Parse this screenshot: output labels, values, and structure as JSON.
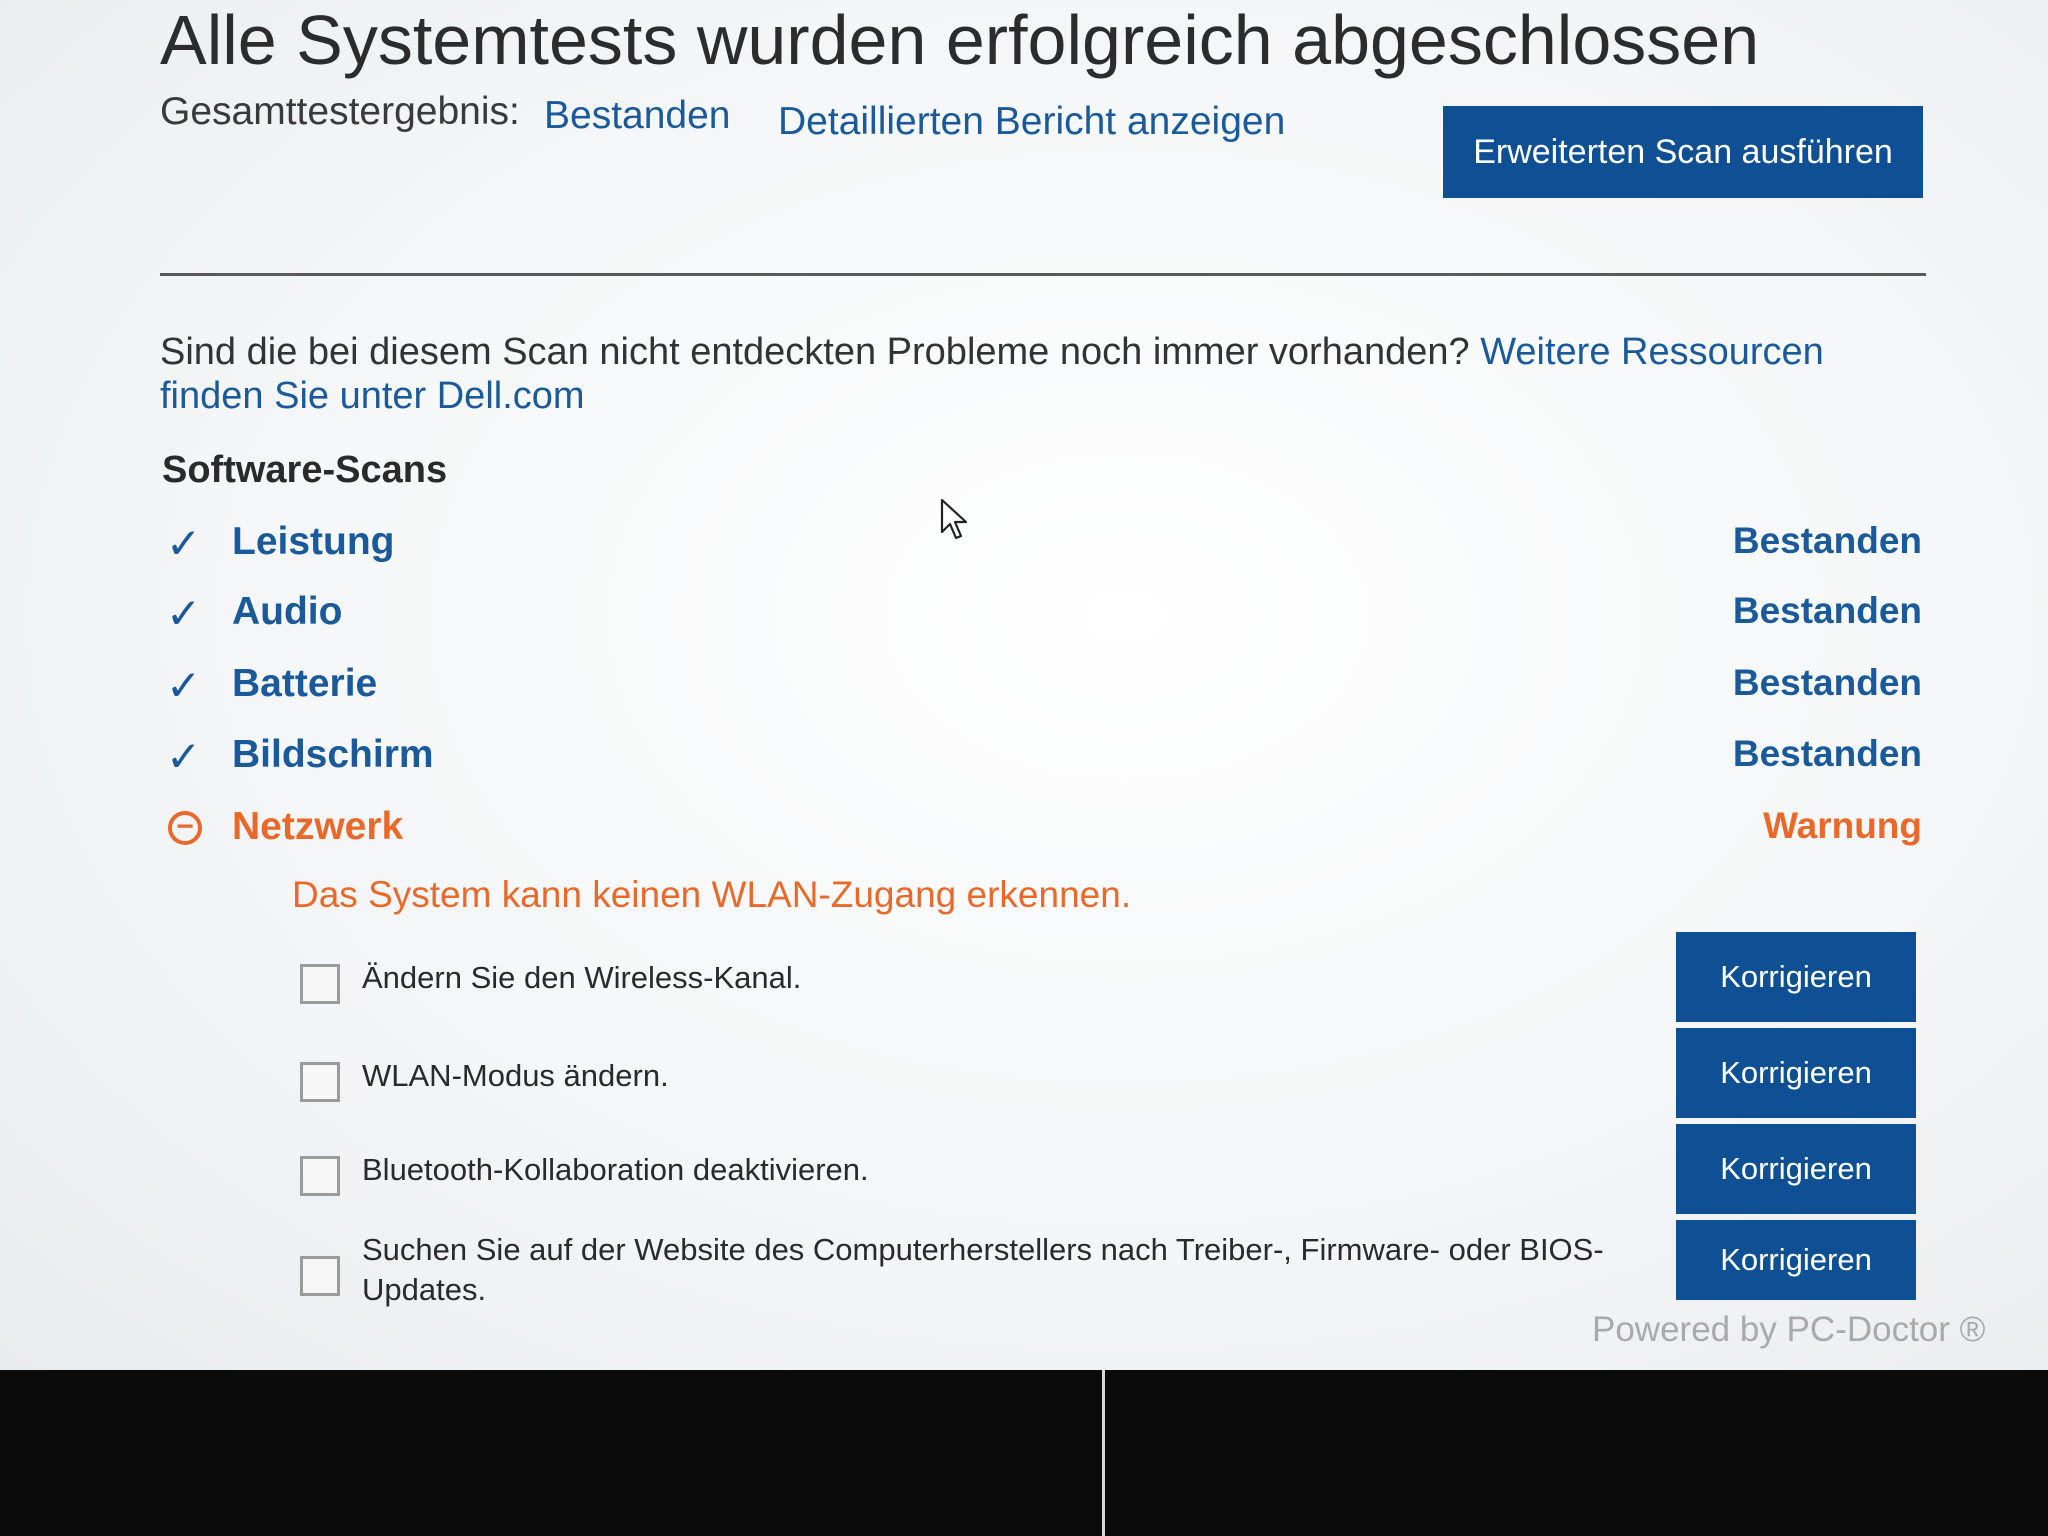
{
  "header": {
    "title": "Alle Systemtests wurden erfolgreich abgeschlossen",
    "result_label": "Gesamttestergebnis:",
    "result_value": "Bestanden",
    "report_link": "Detaillierten Bericht anzeigen",
    "scan_button": "Erweiterten Scan ausführen"
  },
  "resources": {
    "text": "Sind die bei diesem Scan nicht entdeckten Probleme noch immer vorhanden?",
    "link": "Weitere Ressourcen finden Sie unter Dell.com"
  },
  "software_scans": {
    "heading": "Software-Scans",
    "items": [
      {
        "name": "Leistung",
        "status": "Bestanden",
        "icon": "checkmark-icon"
      },
      {
        "name": "Audio",
        "status": "Bestanden",
        "icon": "checkmark-icon"
      },
      {
        "name": "Batterie",
        "status": "Bestanden",
        "icon": "checkmark-icon"
      },
      {
        "name": "Bildschirm",
        "status": "Bestanden",
        "icon": "checkmark-icon"
      },
      {
        "name": "Netzwerk",
        "status": "Warnung",
        "icon": "minus-circle-icon"
      }
    ]
  },
  "network_warning": {
    "message": "Das System kann keinen WLAN-Zugang erkennen.",
    "fixes": [
      {
        "text": "Ändern Sie den Wireless-Kanal.",
        "button": "Korrigieren"
      },
      {
        "text": "WLAN-Modus ändern.",
        "button": "Korrigieren"
      },
      {
        "text": "Bluetooth-Kollaboration deaktivieren.",
        "button": "Korrigieren"
      },
      {
        "text": "Suchen Sie auf der Website des Computerherstellers nach Treiber-, Firmware- oder BIOS-Updates.",
        "button": "Korrigieren"
      }
    ]
  },
  "footer": {
    "powered_by": "Powered by PC-Doctor ®"
  },
  "colors": {
    "accent_blue": "#1a5a9a",
    "button_blue": "#0f4f93",
    "warning_orange": "#e8692a"
  }
}
